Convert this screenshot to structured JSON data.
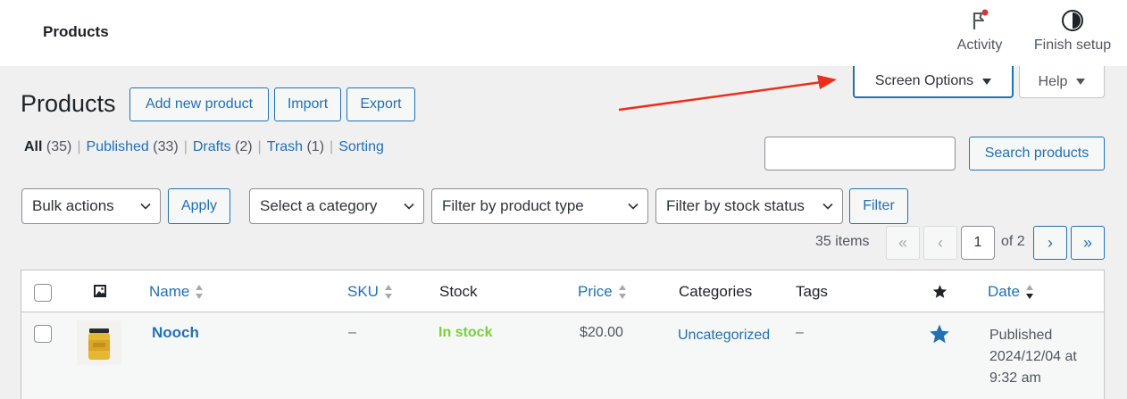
{
  "topbar": {
    "title": "Products",
    "activity_label": "Activity",
    "finish_label": "Finish setup"
  },
  "tabs": {
    "screen_options": "Screen Options",
    "help": "Help"
  },
  "page": {
    "heading": "Products",
    "add_new": "Add new product",
    "import": "Import",
    "export": "Export"
  },
  "views": {
    "all_label": "All",
    "all_count": "(35)",
    "published_label": "Published",
    "published_count": "(33)",
    "drafts_label": "Drafts",
    "drafts_count": "(2)",
    "trash_label": "Trash",
    "trash_count": "(1)",
    "sorting_label": "Sorting",
    "separator": "|"
  },
  "search": {
    "value": "",
    "button": "Search products"
  },
  "filters": {
    "bulk_actions": "Bulk actions",
    "apply": "Apply",
    "category": "Select a category",
    "product_type": "Filter by product type",
    "stock_status": "Filter by stock status",
    "filter": "Filter"
  },
  "pagination": {
    "items": "35 items",
    "first": "«",
    "prev": "‹",
    "current_page": "1",
    "of": "of 2",
    "next": "›",
    "last": "»"
  },
  "table": {
    "columns": {
      "name": "Name",
      "sku": "SKU",
      "stock": "Stock",
      "price": "Price",
      "categories": "Categories",
      "tags": "Tags",
      "date": "Date"
    },
    "rows": [
      {
        "name": "Nooch",
        "sku": "–",
        "stock": "In stock",
        "price": "$20.00",
        "categories": "Uncategorized",
        "tags": "–",
        "date": "Published 2024/12/04 at 9:32 am",
        "featured": true
      }
    ]
  },
  "colors": {
    "accent": "#2271b1",
    "in_stock": "#7ad03a",
    "annotation_arrow": "#e8301c",
    "notification_dot": "#d63638"
  }
}
